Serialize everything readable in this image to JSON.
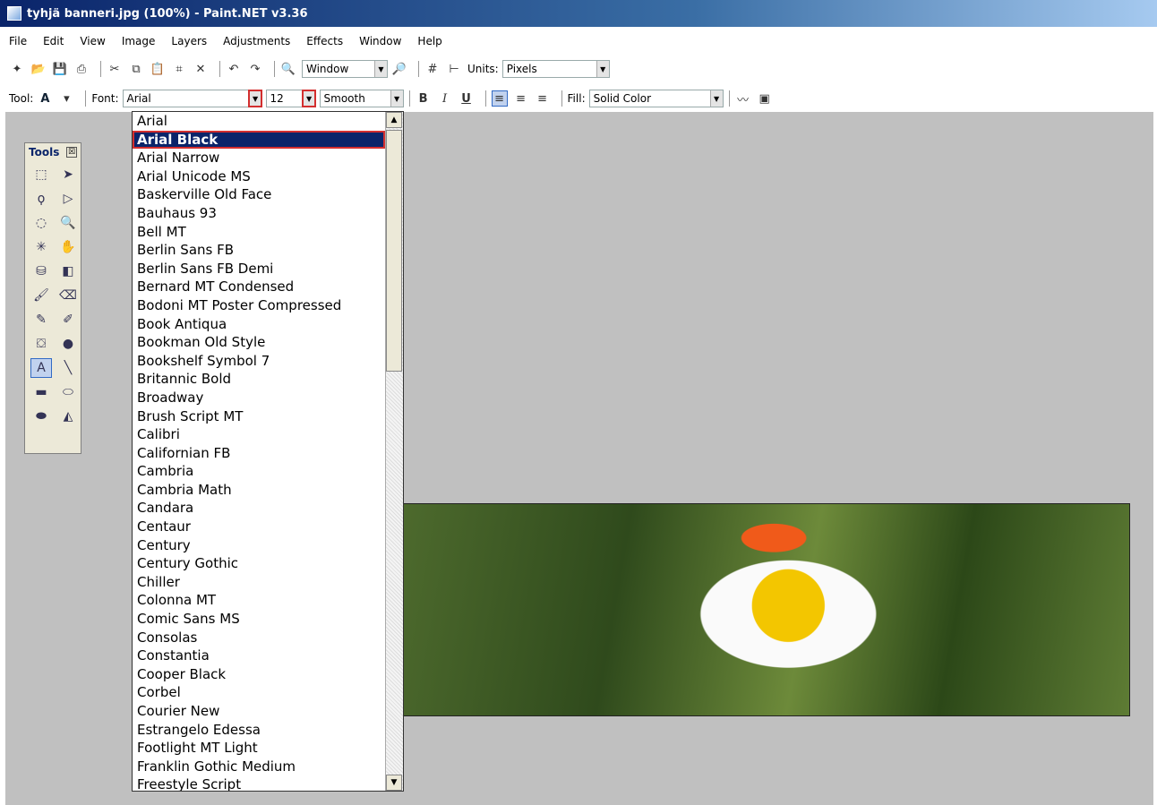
{
  "window": {
    "title": "tyhjä banneri.jpg (100%) - Paint.NET v3.36"
  },
  "menu": [
    "File",
    "Edit",
    "View",
    "Image",
    "Layers",
    "Adjustments",
    "Effects",
    "Window",
    "Help"
  ],
  "toolbar1": {
    "zoom_value": "Window",
    "units_label": "Units:",
    "units_value": "Pixels"
  },
  "toolbar2": {
    "tool_label": "Tool:",
    "tool_value": "A",
    "font_label": "Font:",
    "font_value": "Arial",
    "size_value": "12",
    "antialias_value": "Smooth",
    "bold": "B",
    "italic": "I",
    "underline": "U",
    "fill_label": "Fill:",
    "fill_value": "Solid Color"
  },
  "tools_panel": {
    "title": "Tools",
    "close": "☒"
  },
  "font_list": [
    "Arial",
    "Arial Black",
    "Arial Narrow",
    "Arial Unicode MS",
    "Baskerville Old Face",
    "Bauhaus 93",
    "Bell MT",
    "Berlin Sans FB",
    "Berlin Sans FB Demi",
    "Bernard MT Condensed",
    "Bodoni MT Poster Compressed",
    "Book Antiqua",
    "Bookman Old Style",
    "Bookshelf Symbol 7",
    "Britannic Bold",
    "Broadway",
    "Brush Script MT",
    "Calibri",
    "Californian FB",
    "Cambria",
    "Cambria Math",
    "Candara",
    "Centaur",
    "Century",
    "Century Gothic",
    "Chiller",
    "Colonna MT",
    "Comic Sans MS",
    "Consolas",
    "Constantia",
    "Cooper Black",
    "Corbel",
    "Courier New",
    "Estrangelo Edessa",
    "Footlight MT Light",
    "Franklin Gothic Medium",
    "Freestyle Script"
  ],
  "selected_font": "Arial Black"
}
